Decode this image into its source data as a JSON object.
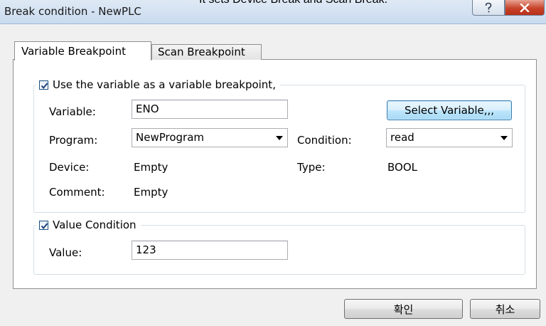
{
  "caption": "It sets Device Break and Scan Break.",
  "window": {
    "title": "Break condition - NewPLC",
    "help_label": "?",
    "close_label": "X"
  },
  "tabs": [
    {
      "label": "Variable Breakpoint",
      "active": true
    },
    {
      "label": "Scan Breakpoint",
      "active": false
    }
  ],
  "variable_group": {
    "checkbox_label": "Use the variable as a variable breakpoint,",
    "checked": true,
    "variable_label": "Variable:",
    "variable_value": "ENO",
    "select_variable_label": "Select Variable,,,",
    "program_label": "Program:",
    "program_value": "NewProgram",
    "condition_label": "Condition:",
    "condition_value": "read",
    "device_label": "Device:",
    "device_value": "Empty",
    "type_label": "Type:",
    "type_value": "BOOL",
    "comment_label": "Comment:",
    "comment_value": "Empty"
  },
  "value_group": {
    "checkbox_label": "Value Condition",
    "checked": true,
    "value_label": "Value:",
    "value_value": "123"
  },
  "footer": {
    "ok_label": "확인",
    "cancel_label": "취소"
  }
}
